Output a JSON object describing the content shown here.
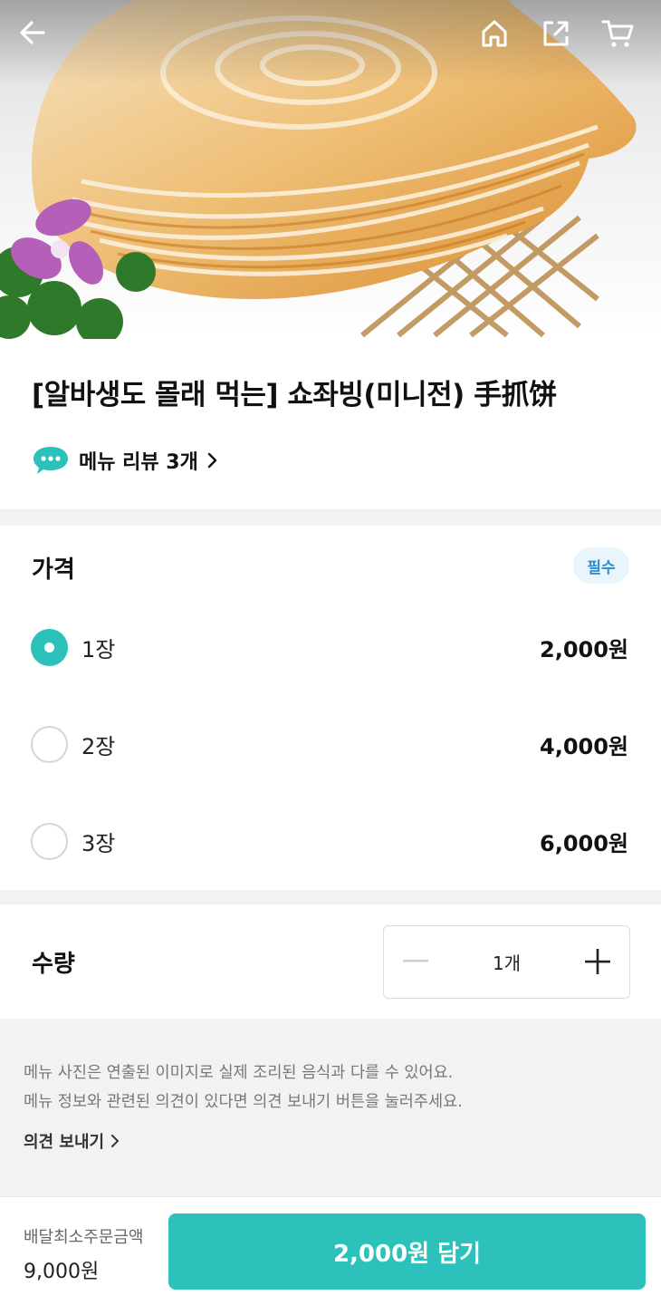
{
  "header": {
    "back_icon": "back-arrow-icon",
    "home_icon": "home-icon",
    "share_icon": "share-icon",
    "cart_icon": "cart-icon"
  },
  "menu": {
    "title": "[알바생도 몰래 먹는] 쇼좌빙(미니전) 手抓饼",
    "review_label": "메뉴 리뷰 3개"
  },
  "price": {
    "section_title": "가격",
    "required_badge": "필수",
    "options": [
      {
        "label": "1장",
        "price": "2,000원",
        "selected": true
      },
      {
        "label": "2장",
        "price": "4,000원",
        "selected": false
      },
      {
        "label": "3장",
        "price": "6,000원",
        "selected": false
      }
    ]
  },
  "quantity": {
    "section_title": "수량",
    "value": "1개"
  },
  "notice": {
    "line1": "메뉴 사진은 연출된 이미지로 실제 조리된 음식과 다를 수 있어요.",
    "line2": "메뉴 정보와 관련된 의견이 있다면 의견 보내기 버튼을 눌러주세요.",
    "feedback_label": "의견 보내기"
  },
  "footer": {
    "min_order_label": "배달최소주문금액",
    "min_order_value": "9,000원",
    "add_button_label": "2,000원 담기"
  },
  "colors": {
    "accent": "#2cc2bb",
    "badge_text": "#2b8fd0",
    "badge_bg": "#e9f4fb",
    "section_bg": "#f1f2f4"
  }
}
